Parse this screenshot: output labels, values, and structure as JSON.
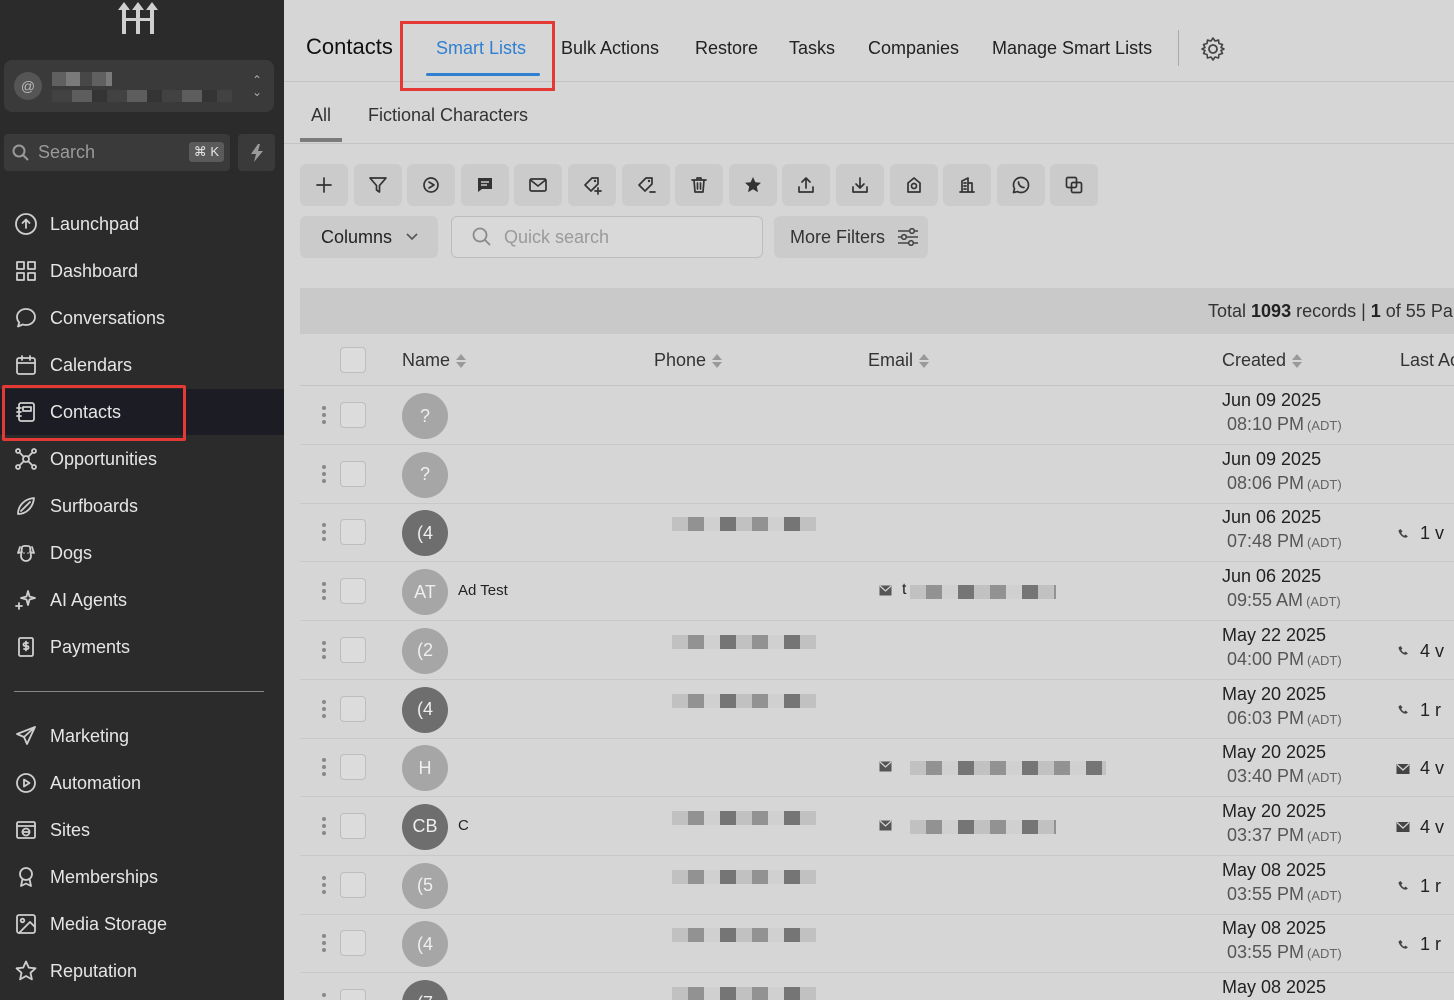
{
  "sidebar": {
    "account_initial": "@",
    "search_label": "Search",
    "search_shortcut": "⌘ K",
    "nav_items": [
      {
        "label": "Launchpad",
        "icon": "launchpad-icon"
      },
      {
        "label": "Dashboard",
        "icon": "dashboard-icon"
      },
      {
        "label": "Conversations",
        "icon": "chat-bubble-icon"
      },
      {
        "label": "Calendars",
        "icon": "calendar-icon"
      },
      {
        "label": "Contacts",
        "icon": "contacts-icon",
        "active": true
      },
      {
        "label": "Opportunities",
        "icon": "opportunities-icon"
      },
      {
        "label": "Surfboards",
        "icon": "surfboard-icon"
      },
      {
        "label": "Dogs",
        "icon": "dog-icon"
      },
      {
        "label": "AI Agents",
        "icon": "sparkle-icon"
      },
      {
        "label": "Payments",
        "icon": "payments-icon"
      },
      {
        "label": "Marketing",
        "icon": "send-icon"
      },
      {
        "label": "Automation",
        "icon": "automation-icon"
      },
      {
        "label": "Sites",
        "icon": "sites-icon"
      },
      {
        "label": "Memberships",
        "icon": "award-icon"
      },
      {
        "label": "Media Storage",
        "icon": "image-icon"
      },
      {
        "label": "Reputation",
        "icon": "star-icon"
      }
    ]
  },
  "header": {
    "title": "Contacts",
    "tabs": [
      "Smart Lists",
      "Bulk Actions",
      "Restore",
      "Tasks",
      "Companies",
      "Manage Smart Lists"
    ],
    "active_tab": "Smart Lists"
  },
  "subtabs": [
    "All",
    "Fictional Characters"
  ],
  "toolbar": {
    "icons": [
      "add-icon",
      "filter-icon",
      "workflow-icon",
      "sms-icon",
      "email-icon",
      "add-tag-icon",
      "remove-tag-icon",
      "delete-icon",
      "star-icon",
      "export-icon",
      "import-icon",
      "review-icon",
      "company-icon",
      "whatsapp-icon",
      "merge-icon"
    ]
  },
  "filters": {
    "columns_label": "Columns",
    "quick_search_placeholder": "Quick search",
    "more_filters_label": "More Filters"
  },
  "records": {
    "prefix": "Total ",
    "total": "1093",
    "middle": " records | ",
    "page": "1",
    "suffix": " of 55 Pa"
  },
  "table": {
    "columns": [
      "Name",
      "Phone",
      "Email",
      "Created",
      "Last Ac"
    ],
    "rows": [
      {
        "avatar": "?",
        "tone": "light",
        "name": "",
        "date": "Jun 09 2025",
        "time": "08:10 PM",
        "tz": "(ADT)",
        "last": ""
      },
      {
        "avatar": "?",
        "tone": "light",
        "name": "",
        "date": "Jun 09 2025",
        "time": "08:06 PM",
        "tz": "(ADT)",
        "last": ""
      },
      {
        "avatar": "(4",
        "tone": "dark",
        "name": "",
        "date": "Jun 06 2025",
        "time": "07:48 PM",
        "tz": "(ADT)",
        "last": "1 v",
        "last_icon": "phone"
      },
      {
        "avatar": "AT",
        "tone": "light",
        "name": "Ad Test",
        "email_prefix": "t",
        "date": "Jun 06 2025",
        "time": "09:55 AM",
        "tz": "(ADT)",
        "last": ""
      },
      {
        "avatar": "(2",
        "tone": "light",
        "name": "",
        "date": "May 22 2025",
        "time": "04:00 PM",
        "tz": "(ADT)",
        "last": "4 v",
        "last_icon": "phone"
      },
      {
        "avatar": "(4",
        "tone": "dark",
        "name": "",
        "date": "May 20 2025",
        "time": "06:03 PM",
        "tz": "(ADT)",
        "last": "1 r",
        "last_icon": "phone"
      },
      {
        "avatar": "H",
        "tone": "light",
        "name": "",
        "date": "May 20 2025",
        "time": "03:40 PM",
        "tz": "(ADT)",
        "last": "4 v",
        "last_icon": "mail"
      },
      {
        "avatar": "CB",
        "tone": "dark",
        "name": "C",
        "date": "May 20 2025",
        "time": "03:37 PM",
        "tz": "(ADT)",
        "last": "4 v",
        "last_icon": "mail"
      },
      {
        "avatar": "(5",
        "tone": "light",
        "name": "",
        "date": "May 08 2025",
        "time": "03:55 PM",
        "tz": "(ADT)",
        "last": "1 r",
        "last_icon": "phone"
      },
      {
        "avatar": "(4",
        "tone": "light",
        "name": "",
        "date": "May 08 2025",
        "time": "03:55 PM",
        "tz": "(ADT)",
        "last": "1 r",
        "last_icon": "phone"
      },
      {
        "avatar": "(7",
        "tone": "dark",
        "name": "",
        "date": "May 08 2025",
        "time": "",
        "tz": "",
        "last": ""
      }
    ]
  },
  "colors": {
    "accent": "#2f80d1",
    "highlight": "#e53935",
    "sidebar_bg": "#2b2b2b"
  }
}
